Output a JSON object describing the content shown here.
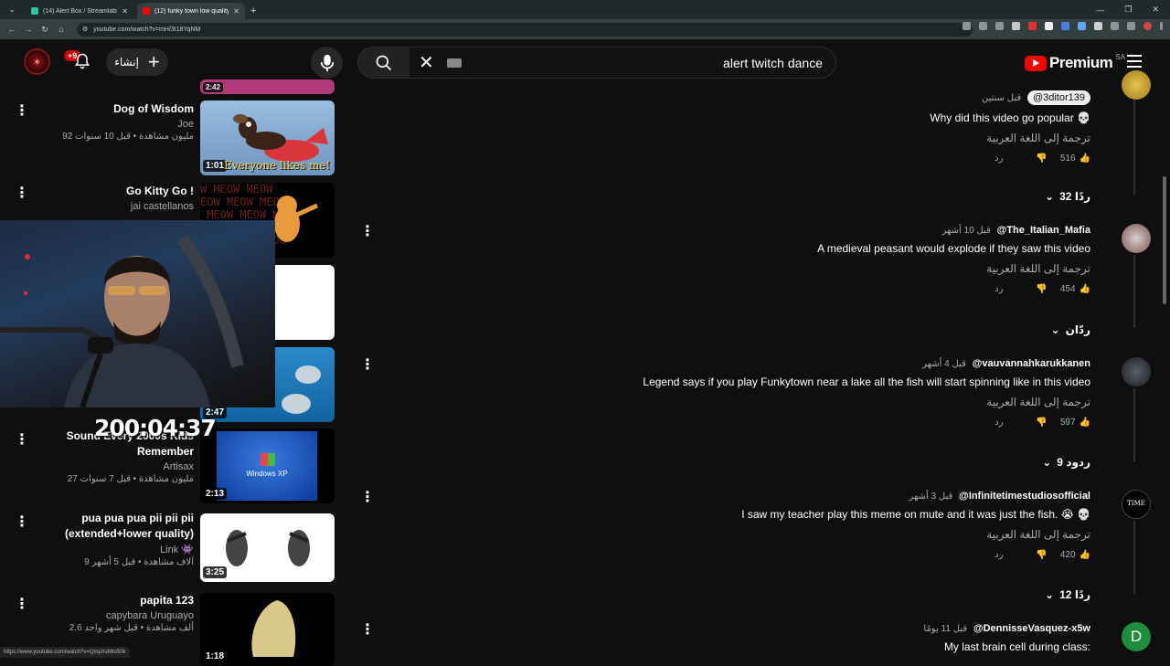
{
  "browser": {
    "tabs": [
      {
        "title": "(14) Alert Box / Streamlabs",
        "icon_color": "#31c3a2"
      },
      {
        "title": "(12) funky town low quality",
        "icon_color": "#ff0000"
      }
    ],
    "url": "youtube.com/watch?v=mH/3I18YqNM",
    "status_url": "https://www.youtube.com/watch?v=QmpXsMto50k"
  },
  "header": {
    "notification_count": "+9",
    "create_label": "إنشاء",
    "search_query": "alert twitch dance",
    "logo_text": "Premium",
    "country_code": "SA"
  },
  "related": [
    {
      "title": "Dog of Wisdom",
      "channel": "Joe",
      "stats": "92 مليون مشاهدة • قبل 10 سنوات",
      "duration": "1:01",
      "overlay_text": "Everyone likes me!"
    },
    {
      "title": "Go Kitty Go !",
      "channel": "jai castellanos",
      "stats": "",
      "duration": ""
    },
    {
      "title": "Sound Every 2000s Kids Remember",
      "channel": "Artisax",
      "stats": "27 مليون مشاهدة • قبل 7 سنوات",
      "duration": "2:13",
      "overlay_text": "Windows XP"
    },
    {
      "title": "pua pua pua pii pii pii (extended+lower quality)",
      "channel": "Link 👾",
      "stats": "9 آلاف مشاهدة • قبل 5 أشهر",
      "duration": "3:25"
    },
    {
      "title": "papita 123",
      "channel": "capybara Uruguayo",
      "stats": "2.6 ألف مشاهدة • قبل شهر واحد",
      "duration": "1:18"
    }
  ],
  "hidden_durations": {
    "seal": "2:47",
    "partial_top": "2:42"
  },
  "stream_timer": "200:04:37",
  "comments": [
    {
      "author": "@3ditor139",
      "time": "قبل سنتين",
      "text": "Why did this video go popular 💀",
      "translate": "ترجمة إلى اللغة العربية",
      "likes": "516",
      "reply": "رد",
      "replies": "32 ردًا"
    },
    {
      "author": "@The_Italian_Mafia",
      "time": "قبل 10 أشهر",
      "text": "A medieval peasant would explode if they saw this video",
      "translate": "ترجمة إلى اللغة العربية",
      "likes": "454",
      "reply": "رد",
      "replies": "ردّان"
    },
    {
      "author": "@vauvannahkarukkanen",
      "time": "قبل 4 أشهر",
      "text": "Legend says if you play Funkytown near a lake all the fish will start spinning like in this video",
      "translate": "ترجمة إلى اللغة العربية",
      "likes": "597",
      "reply": "رد",
      "replies": "9 ردود"
    },
    {
      "author": "@Infinitetimestudiosofficial",
      "time": "قبل 3 أشهر",
      "text": "I saw my teacher play this meme on mute and it was just the fish. 😭 💀",
      "translate": "ترجمة إلى اللغة العربية",
      "likes": "420",
      "reply": "رد",
      "replies": "12 ردًا"
    },
    {
      "author": "@DennisseVasquez-x5w",
      "time": "قبل 11 يومًا",
      "text": "My last brain cell during class:",
      "avatar_letter": "D"
    }
  ],
  "colors": {
    "accent_red": "#ff0000",
    "bg": "#0f0f0f",
    "avatar_green": "#1e8e3e"
  }
}
